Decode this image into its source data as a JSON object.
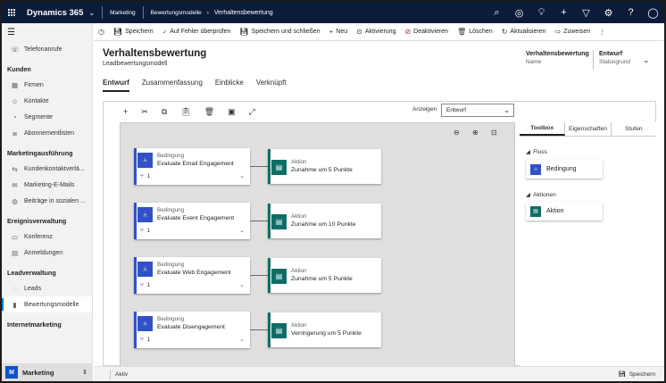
{
  "app": {
    "name": "Dynamics 365",
    "area": "Marketing"
  },
  "breadcrumb": {
    "area": "Marketing",
    "entity": "Bewertungsmodelle",
    "current": "Verhaltensbewertung"
  },
  "top_icons": [
    "search-icon",
    "goal-icon",
    "lightbulb-icon",
    "plus-icon",
    "filter-icon",
    "gear-icon",
    "help-icon",
    "person-icon"
  ],
  "commands": [
    {
      "name": "history",
      "icon": "history-icon",
      "label": ""
    },
    {
      "name": "save",
      "icon": "save-icon",
      "label": "Speichern"
    },
    {
      "name": "check-errors",
      "icon": "check-icon",
      "label": "Auf Fehler überprüfen"
    },
    {
      "name": "save-close",
      "icon": "save-close-icon",
      "label": "Speichern und schließen"
    },
    {
      "name": "new",
      "icon": "plus-icon",
      "label": "Neu"
    },
    {
      "name": "activate",
      "icon": "activate-icon",
      "label": "Aktivierung"
    },
    {
      "name": "deactivate",
      "icon": "deactivate-icon",
      "label": "Deaktivieren"
    },
    {
      "name": "delete",
      "icon": "trash-icon",
      "label": "Löschen"
    },
    {
      "name": "refresh",
      "icon": "refresh-icon",
      "label": "Aktualisieren"
    },
    {
      "name": "assign",
      "icon": "assign-icon",
      "label": "Zuweisen"
    },
    {
      "name": "more",
      "icon": "more-icon",
      "label": "⋮"
    }
  ],
  "sidebar": {
    "groups": [
      {
        "title": "",
        "items": [
          {
            "label": "Telefonanrufe",
            "icon": "phone-icon"
          }
        ]
      },
      {
        "title": "Kunden",
        "items": [
          {
            "label": "Firmen",
            "icon": "building-icon"
          },
          {
            "label": "Kontakte",
            "icon": "contact-icon"
          },
          {
            "label": "Segmente",
            "icon": "segment-icon"
          },
          {
            "label": "Abonnementlisten",
            "icon": "list-icon"
          }
        ]
      },
      {
        "title": "Marketingausführung",
        "items": [
          {
            "label": "Kundenkontaktverlä...",
            "icon": "journey-icon"
          },
          {
            "label": "Marketing-E-Mails",
            "icon": "mail-icon"
          },
          {
            "label": "Beiträge in sozialen ...",
            "icon": "social-icon"
          }
        ]
      },
      {
        "title": "Ereignisverwaltung",
        "items": [
          {
            "label": "Konferenz",
            "icon": "event-icon"
          },
          {
            "label": "Anmeldungen",
            "icon": "registration-icon"
          }
        ]
      },
      {
        "title": "Leadverwaltung",
        "items": [
          {
            "label": "Leads",
            "icon": "lead-icon"
          },
          {
            "label": "Bewertungsmodelle",
            "icon": "scoring-icon",
            "selected": true
          }
        ]
      },
      {
        "title": "Internetmarketing",
        "items": []
      }
    ],
    "area_switcher": {
      "badge": "M",
      "label": "Marketing"
    }
  },
  "record": {
    "title": "Verhaltensbewertung",
    "subtitle": "Leadbewertungsmodell",
    "name_value": "Verhaltensbewertung",
    "name_label": "Name",
    "status_value": "Entwurf",
    "status_label": "Statusgrund"
  },
  "tabs": [
    "Entwurf",
    "Zusammenfassung",
    "Einblicke",
    "Verknüpft"
  ],
  "designer": {
    "show_label": "Anzeigen",
    "show_value": "Entwurf",
    "rows": [
      {
        "cond_kind": "Bedingung",
        "cond_name": "Evaluate Email Engagement",
        "count": "1",
        "act_kind": "Aktion",
        "act_name": "Zunahme um 5 Punkte"
      },
      {
        "cond_kind": "Bedingung",
        "cond_name": "Evaluate Event Engagement",
        "count": "1",
        "act_kind": "Aktion",
        "act_name": "Zunahme um 10 Punkte"
      },
      {
        "cond_kind": "Bedingung",
        "cond_name": "Evaluate Web Engagement",
        "count": "1",
        "act_kind": "Aktion",
        "act_name": "Zunahme um 5 Punkte"
      },
      {
        "cond_kind": "Bedingung",
        "cond_name": "Evaluate Disengagement",
        "count": "1",
        "act_kind": "Aktion",
        "act_name": "Verringerung um 5 Punkte"
      }
    ]
  },
  "panel": {
    "tabs": [
      "Toolbox",
      "Eigenschaften",
      "Stufen"
    ],
    "flow_section": "Fluss",
    "flow_item": "Bedingung",
    "actions_section": "Aktionen",
    "action_item": "Aktion"
  },
  "status": {
    "text": "Aktiv",
    "save": "Speichern"
  }
}
